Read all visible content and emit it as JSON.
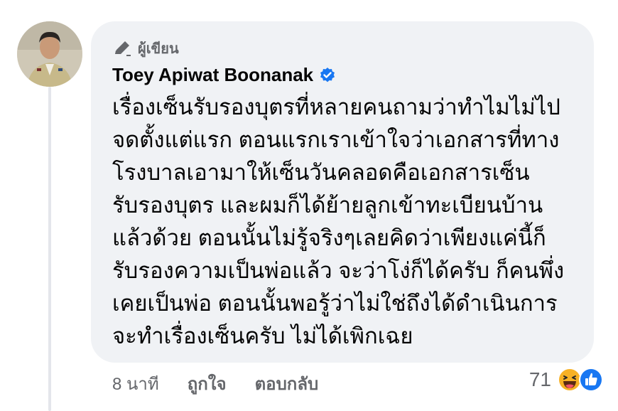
{
  "comment": {
    "author_badge": "ผู้เขียน",
    "author_name": "Toey Apiwat Boonanak",
    "verified_icon": "verified-badge-icon",
    "text": "เรื่องเซ็นรับรองบุตรที่หลายคนถามว่าทำไมไม่ไป\nจดตั้งแต่แรก ตอนแรกเราเข้าใจว่าเอกสารที่ทาง\nโรงบาลเอามาให้เซ็นวันคลอดคือเอกสารเซ็น\nรับรองบุตร และผมก็ได้ย้ายลูกเข้าทะเบียนบ้าน\nแล้วด้วย ตอนนั้นไม่รู้จริงๆเลยคิดว่าเพียงแค่นี้ก็\nรับรองความเป็นพ่อแล้ว จะว่าโง่ก็ได้ครับ ก็คนพึ่ง\nเคยเป็นพ่อ ตอนนั้นพอรู้ว่าไม่ใช่ถึงได้ดำเนินการ\nจะทำเรื่องเซ็นครับ ไม่ได้เพิกเฉย"
  },
  "footer": {
    "time": "8 นาที",
    "like": "ถูกใจ",
    "reply": "ตอบกลับ"
  },
  "reactions": {
    "count": "71",
    "icons": [
      "haha-reaction-icon",
      "like-reaction-icon"
    ],
    "like_color": "#1877f2",
    "haha_color": "#f7b125"
  }
}
